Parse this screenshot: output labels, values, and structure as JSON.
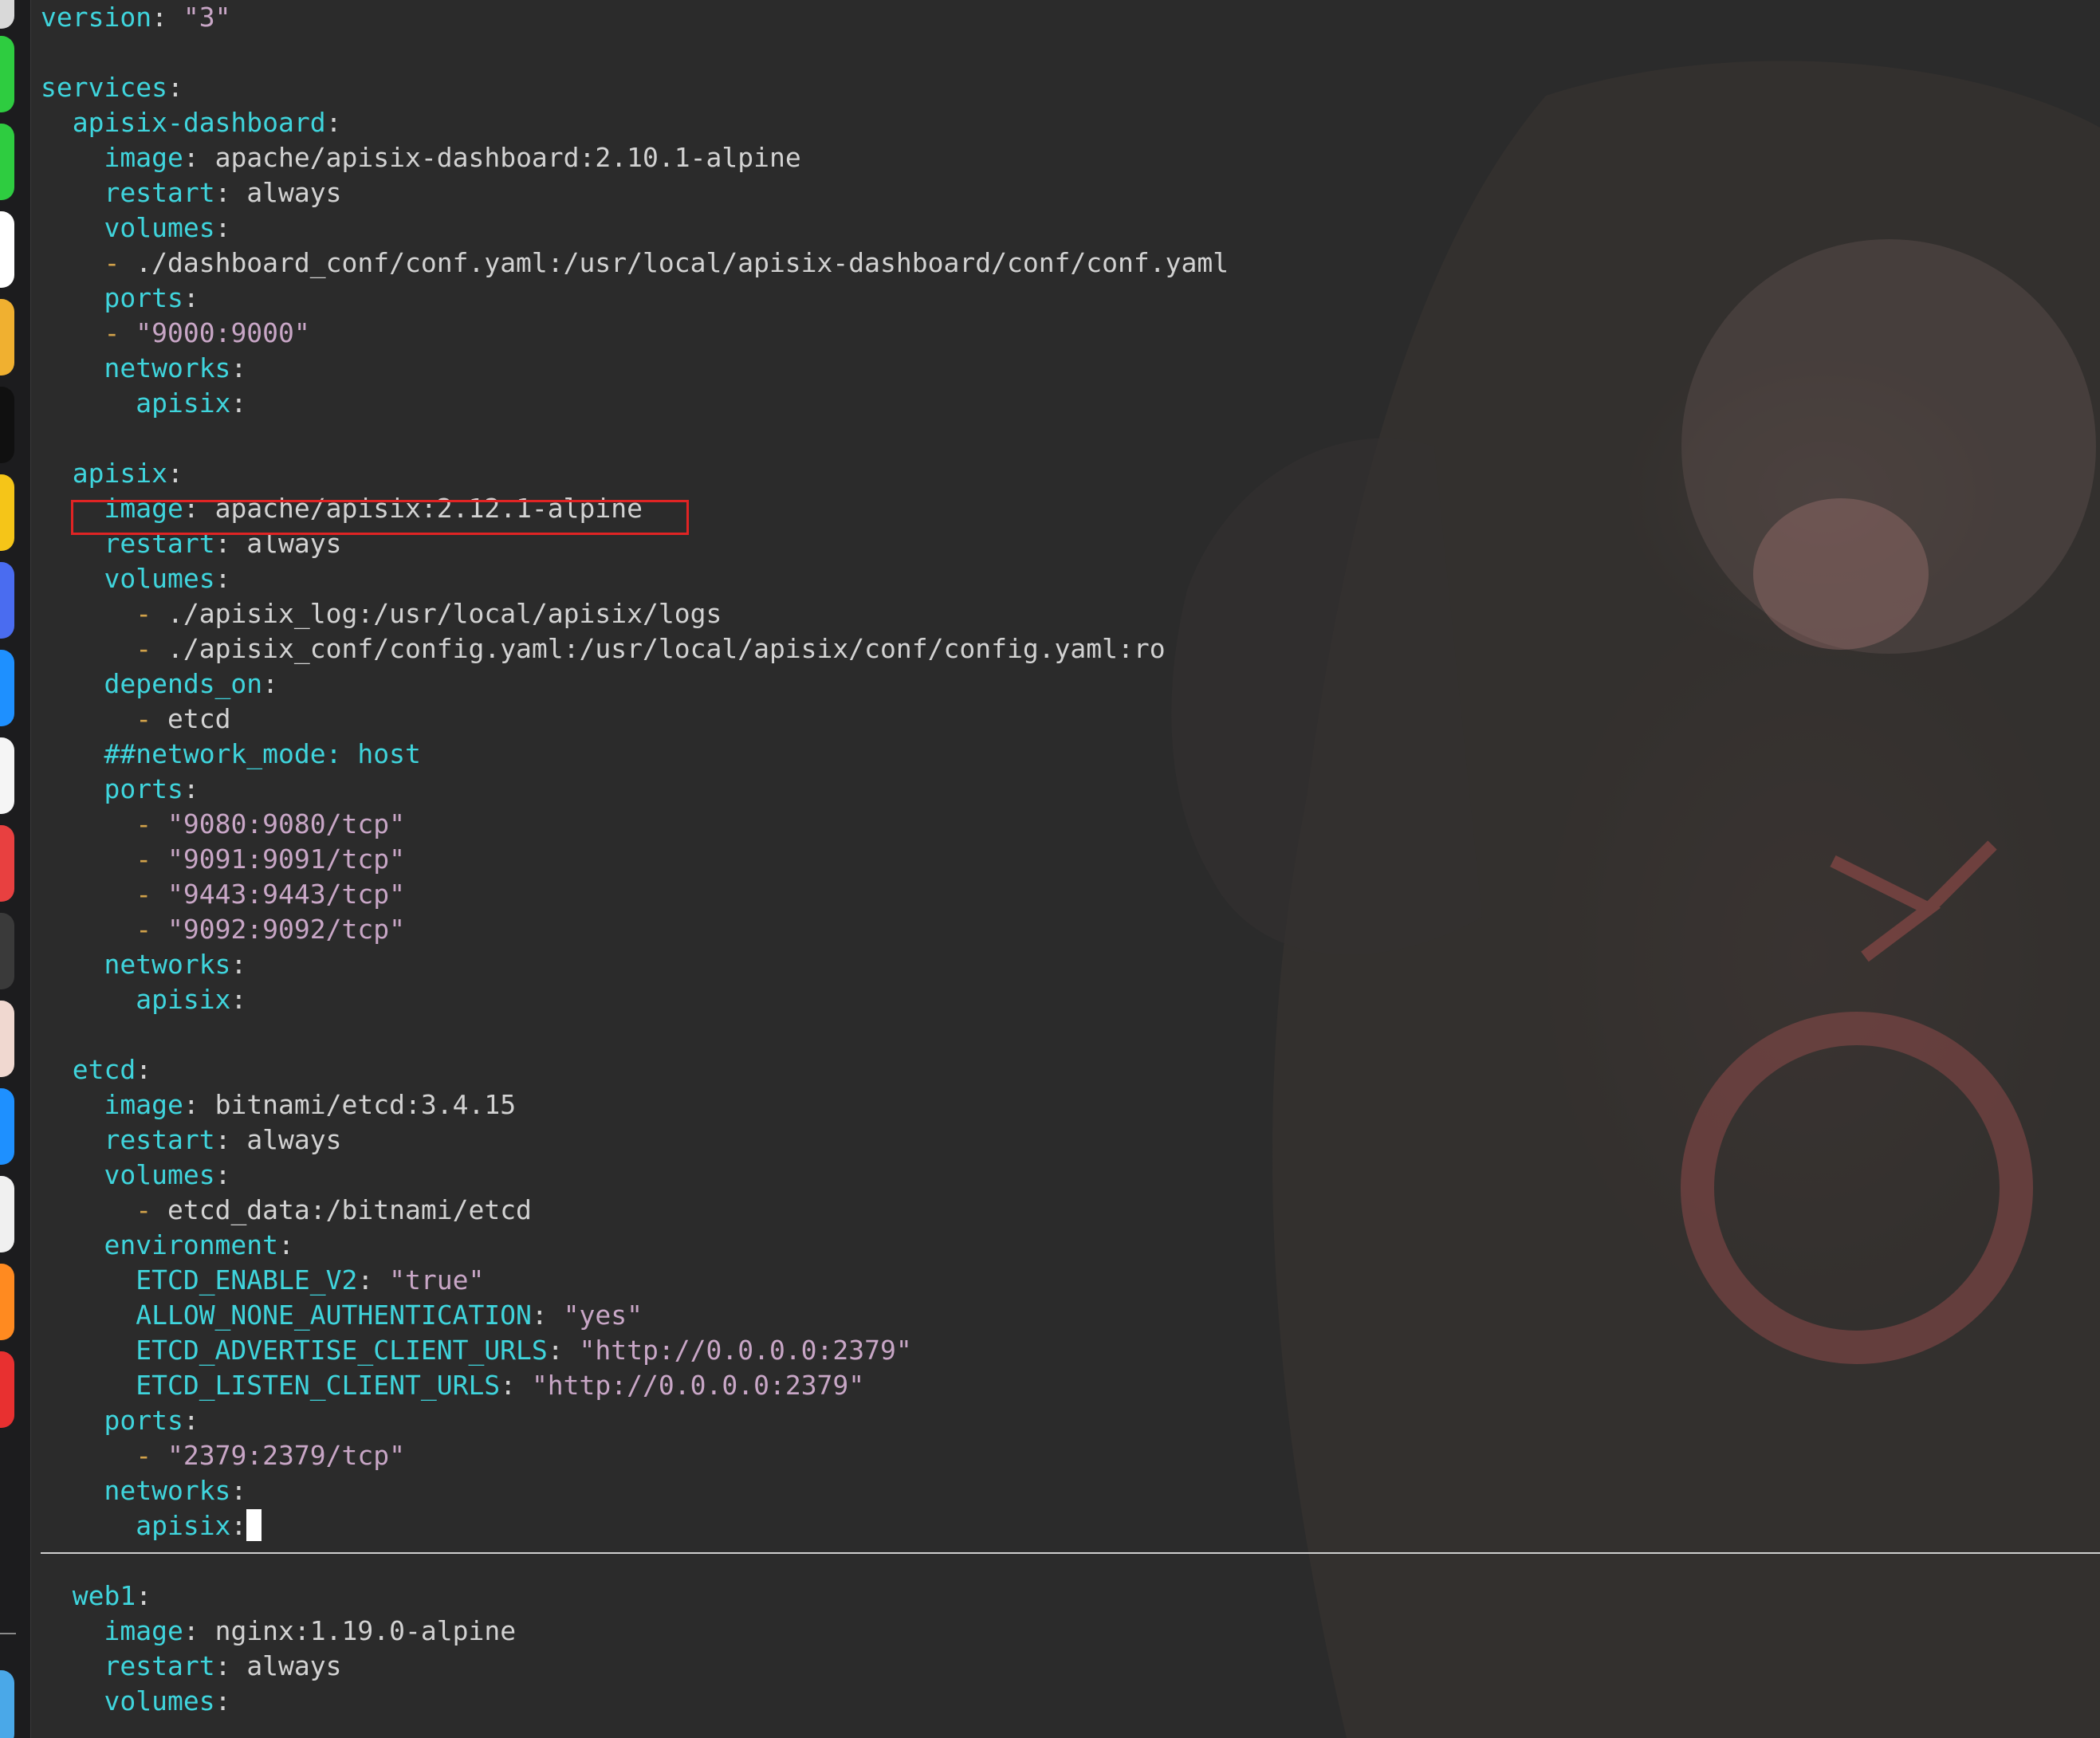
{
  "highlight": {
    "color": "#e02424"
  },
  "colors": {
    "key": "#3fd4dc",
    "value": "#d2d2d2",
    "string": "#c8a6c6",
    "dash": "#d2a24a",
    "background": "#2b2b2b"
  },
  "dock": {
    "icons": [
      "finder-icon",
      "messages-icon",
      "wechat-icon",
      "mail-icon",
      "chrome-icon",
      "terminal-icon",
      "notes-icon",
      "app-icon",
      "vscode-icon",
      "safari-icon",
      "app-icon",
      "app-icon",
      "app-icon",
      "app-icon",
      "app-icon",
      "app-icon",
      "app-icon"
    ]
  },
  "code": {
    "lines": [
      {
        "indent": "",
        "tokens": [
          [
            "key",
            "version"
          ],
          [
            "punc",
            ": "
          ],
          [
            "str",
            "\"3\""
          ]
        ]
      },
      {
        "indent": "",
        "tokens": []
      },
      {
        "indent": "",
        "tokens": [
          [
            "key",
            "services"
          ],
          [
            "punc",
            ":"
          ]
        ]
      },
      {
        "indent": "  ",
        "tokens": [
          [
            "key",
            "apisix-dashboard"
          ],
          [
            "punc",
            ":"
          ]
        ]
      },
      {
        "indent": "    ",
        "tokens": [
          [
            "key",
            "image"
          ],
          [
            "punc",
            ": "
          ],
          [
            "val",
            "apache/apisix-dashboard:2.10.1-alpine"
          ]
        ]
      },
      {
        "indent": "    ",
        "tokens": [
          [
            "key",
            "restart"
          ],
          [
            "punc",
            ": "
          ],
          [
            "val",
            "always"
          ]
        ]
      },
      {
        "indent": "    ",
        "tokens": [
          [
            "key",
            "volumes"
          ],
          [
            "punc",
            ":"
          ]
        ]
      },
      {
        "indent": "    ",
        "tokens": [
          [
            "dash",
            "- "
          ],
          [
            "val",
            "./dashboard_conf/conf.yaml:/usr/local/apisix-dashboard/conf/conf.yaml"
          ]
        ]
      },
      {
        "indent": "    ",
        "tokens": [
          [
            "key",
            "ports"
          ],
          [
            "punc",
            ":"
          ]
        ]
      },
      {
        "indent": "    ",
        "tokens": [
          [
            "dash",
            "- "
          ],
          [
            "str",
            "\"9000:9000\""
          ]
        ]
      },
      {
        "indent": "    ",
        "tokens": [
          [
            "key",
            "networks"
          ],
          [
            "punc",
            ":"
          ]
        ]
      },
      {
        "indent": "      ",
        "tokens": [
          [
            "key",
            "apisix"
          ],
          [
            "punc",
            ":"
          ]
        ]
      },
      {
        "indent": "",
        "tokens": []
      },
      {
        "indent": "  ",
        "tokens": [
          [
            "key",
            "apisix"
          ],
          [
            "punc",
            ":"
          ]
        ]
      },
      {
        "indent": "    ",
        "tokens": [
          [
            "key",
            "image"
          ],
          [
            "punc",
            ": "
          ],
          [
            "val",
            "apache/apisix:2.12.1-alpine"
          ]
        ]
      },
      {
        "indent": "    ",
        "tokens": [
          [
            "key",
            "restart"
          ],
          [
            "punc",
            ": "
          ],
          [
            "val",
            "always"
          ]
        ]
      },
      {
        "indent": "    ",
        "tokens": [
          [
            "key",
            "volumes"
          ],
          [
            "punc",
            ":"
          ]
        ]
      },
      {
        "indent": "      ",
        "tokens": [
          [
            "dash",
            "- "
          ],
          [
            "val",
            "./apisix_log:/usr/local/apisix/logs"
          ]
        ]
      },
      {
        "indent": "      ",
        "tokens": [
          [
            "dash",
            "- "
          ],
          [
            "val",
            "./apisix_conf/config.yaml:/usr/local/apisix/conf/config.yaml:ro"
          ]
        ]
      },
      {
        "indent": "    ",
        "tokens": [
          [
            "key",
            "depends_on"
          ],
          [
            "punc",
            ":"
          ]
        ]
      },
      {
        "indent": "      ",
        "tokens": [
          [
            "dash",
            "- "
          ],
          [
            "val",
            "etcd"
          ]
        ]
      },
      {
        "indent": "    ",
        "tokens": [
          [
            "comment",
            "##network_mode: host"
          ]
        ]
      },
      {
        "indent": "    ",
        "tokens": [
          [
            "key",
            "ports"
          ],
          [
            "punc",
            ":"
          ]
        ]
      },
      {
        "indent": "      ",
        "tokens": [
          [
            "dash",
            "- "
          ],
          [
            "str",
            "\"9080:9080/tcp\""
          ]
        ]
      },
      {
        "indent": "      ",
        "tokens": [
          [
            "dash",
            "- "
          ],
          [
            "str",
            "\"9091:9091/tcp\""
          ]
        ]
      },
      {
        "indent": "      ",
        "tokens": [
          [
            "dash",
            "- "
          ],
          [
            "str",
            "\"9443:9443/tcp\""
          ]
        ]
      },
      {
        "indent": "      ",
        "tokens": [
          [
            "dash",
            "- "
          ],
          [
            "str",
            "\"9092:9092/tcp\""
          ]
        ]
      },
      {
        "indent": "    ",
        "tokens": [
          [
            "key",
            "networks"
          ],
          [
            "punc",
            ":"
          ]
        ]
      },
      {
        "indent": "      ",
        "tokens": [
          [
            "key",
            "apisix"
          ],
          [
            "punc",
            ":"
          ]
        ]
      },
      {
        "indent": "",
        "tokens": []
      },
      {
        "indent": "  ",
        "tokens": [
          [
            "key",
            "etcd"
          ],
          [
            "punc",
            ":"
          ]
        ]
      },
      {
        "indent": "    ",
        "tokens": [
          [
            "key",
            "image"
          ],
          [
            "punc",
            ": "
          ],
          [
            "val",
            "bitnami/etcd:3.4.15"
          ]
        ]
      },
      {
        "indent": "    ",
        "tokens": [
          [
            "key",
            "restart"
          ],
          [
            "punc",
            ": "
          ],
          [
            "val",
            "always"
          ]
        ]
      },
      {
        "indent": "    ",
        "tokens": [
          [
            "key",
            "volumes"
          ],
          [
            "punc",
            ":"
          ]
        ]
      },
      {
        "indent": "      ",
        "tokens": [
          [
            "dash",
            "- "
          ],
          [
            "val",
            "etcd_data:/bitnami/etcd"
          ]
        ]
      },
      {
        "indent": "    ",
        "tokens": [
          [
            "key",
            "environment"
          ],
          [
            "punc",
            ":"
          ]
        ]
      },
      {
        "indent": "      ",
        "tokens": [
          [
            "key",
            "ETCD_ENABLE_V2"
          ],
          [
            "punc",
            ": "
          ],
          [
            "str",
            "\"true\""
          ]
        ]
      },
      {
        "indent": "      ",
        "tokens": [
          [
            "key",
            "ALLOW_NONE_AUTHENTICATION"
          ],
          [
            "punc",
            ": "
          ],
          [
            "str",
            "\"yes\""
          ]
        ]
      },
      {
        "indent": "      ",
        "tokens": [
          [
            "key",
            "ETCD_ADVERTISE_CLIENT_URLS"
          ],
          [
            "punc",
            ": "
          ],
          [
            "str",
            "\"http://0.0.0.0:2379\""
          ]
        ]
      },
      {
        "indent": "      ",
        "tokens": [
          [
            "key",
            "ETCD_LISTEN_CLIENT_URLS"
          ],
          [
            "punc",
            ": "
          ],
          [
            "str",
            "\"http://0.0.0.0:2379\""
          ]
        ]
      },
      {
        "indent": "    ",
        "tokens": [
          [
            "key",
            "ports"
          ],
          [
            "punc",
            ":"
          ]
        ]
      },
      {
        "indent": "      ",
        "tokens": [
          [
            "dash",
            "- "
          ],
          [
            "str",
            "\"2379:2379/tcp\""
          ]
        ]
      },
      {
        "indent": "    ",
        "tokens": [
          [
            "key",
            "networks"
          ],
          [
            "punc",
            ":"
          ]
        ]
      },
      {
        "indent": "      ",
        "tokens": [
          [
            "key",
            "apisix"
          ],
          [
            "punc",
            ":"
          ]
        ],
        "cursor": true
      },
      {
        "indent": "",
        "tokens": []
      },
      {
        "indent": "  ",
        "tokens": [
          [
            "key",
            "web1"
          ],
          [
            "punc",
            ":"
          ]
        ]
      },
      {
        "indent": "    ",
        "tokens": [
          [
            "key",
            "image"
          ],
          [
            "punc",
            ": "
          ],
          [
            "val",
            "nginx:1.19.0-alpine"
          ]
        ]
      },
      {
        "indent": "    ",
        "tokens": [
          [
            "key",
            "restart"
          ],
          [
            "punc",
            ": "
          ],
          [
            "val",
            "always"
          ]
        ]
      },
      {
        "indent": "    ",
        "tokens": [
          [
            "key",
            "volumes"
          ],
          [
            "punc",
            ":"
          ]
        ]
      }
    ]
  }
}
